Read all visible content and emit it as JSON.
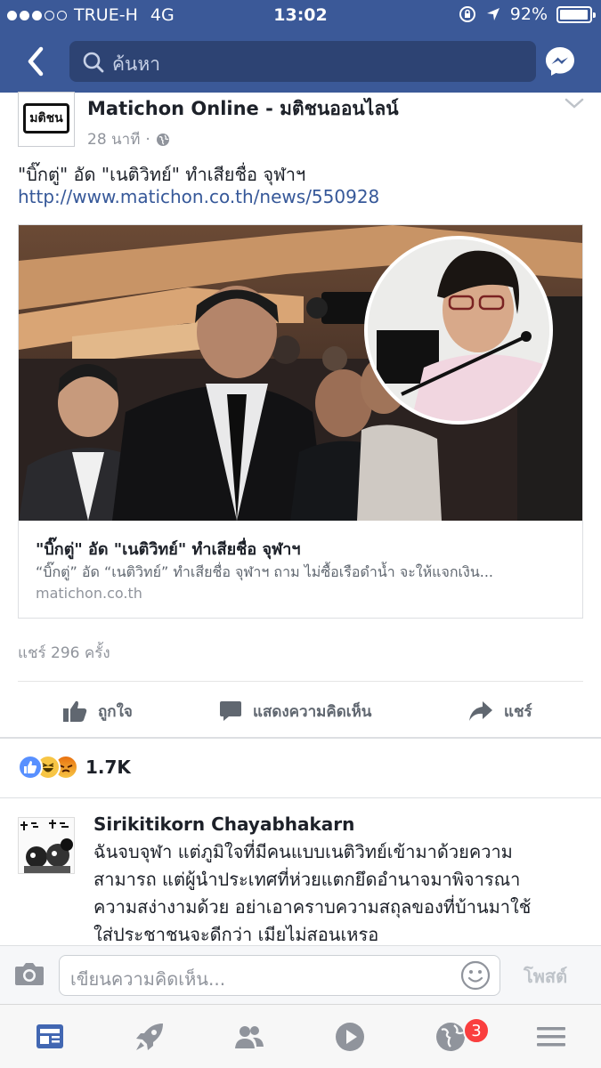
{
  "status_bar": {
    "carrier": "TRUE-H",
    "network": "4G",
    "time": "13:02",
    "battery": "92%"
  },
  "nav": {
    "search_placeholder": "ค้นหา"
  },
  "post": {
    "avatar_text": "มติชน",
    "page_name": "Matichon Online - มติชนออนไลน์",
    "time_ago": "28 นาที",
    "text": "\"บิ๊กตู่\" อัด \"เนติวิทย์\" ทำเสียชื่อ จุฬาฯ",
    "link": "http://www.matichon.co.th/news/550928",
    "card": {
      "title": "\"บิ๊กตู่\" อัด \"เนติวิทย์\" ทำเสียชื่อ จุฬาฯ",
      "description": "“บิ๊กตู่” อัด “เนติวิทย์” ทำเสียชื่อ จุฬาฯ ถาม ไม่ซื้อเรือดำน้ำ จะให้แจกเงิน...",
      "domain": "matichon.co.th"
    },
    "shares": "แชร์ 296 ครั้ง",
    "actions": {
      "like": "ถูกใจ",
      "comment": "แสดงความคิดเห็น",
      "share": "แชร์"
    },
    "reaction_count": "1.7K"
  },
  "comment": {
    "author": "Sirikitikorn Chayabhakarn",
    "lines": [
      "ฉันจบจุฬา แต่ภูมิใจที่มีคนแบบเนติวิทย์เข้ามาด้วยความ",
      "สามารถ แต่ผู้นำประเทศที่ห่วยแตกยึดอำนาจมาพิจารณา",
      "ความสง่างามด้วย อย่าเอาคราบความสถุลของที่บ้านมาใช้",
      "ใส่ประชาชนจะดีกว่า เมียไม่สอนเหรอ"
    ]
  },
  "composer": {
    "placeholder": "เขียนความคิดเห็น...",
    "post_label": "โพสต์"
  },
  "tabbar": {
    "notifications_badge": "3"
  },
  "colors": {
    "brand": "#3b5998",
    "link": "#365899",
    "badge": "#fa3e3e"
  }
}
